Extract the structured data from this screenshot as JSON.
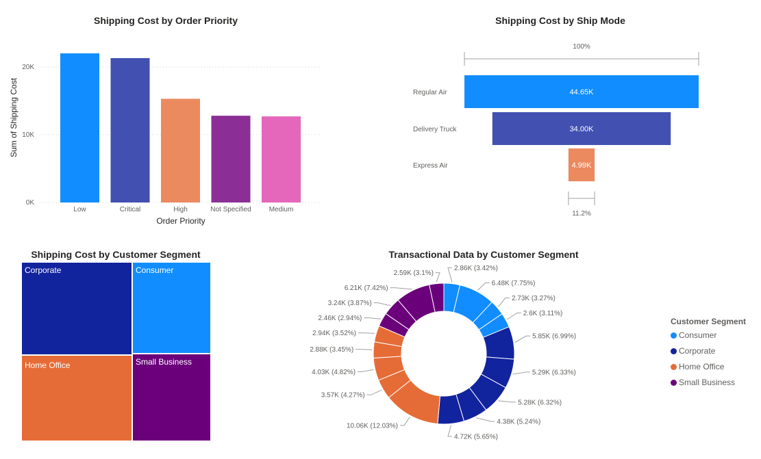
{
  "colors": {
    "Consumer": "#118DFF",
    "Corporate": "#12239E",
    "Home Office": "#E66C37",
    "Small Business": "#6B007B",
    "Not Specified": "#8B2F96",
    "Medium": "#E467BC",
    "Critical": "#4250B1",
    "High": "#EB895F"
  },
  "chart_data": [
    {
      "type": "bar",
      "title": "Shipping Cost by Order Priority",
      "xlabel": "Order Priority",
      "ylabel": "Sum of Shipping Cost",
      "categories": [
        "Low",
        "Critical",
        "High",
        "Not Specified",
        "Medium"
      ],
      "values": [
        22000,
        21300,
        15300,
        12800,
        12700
      ],
      "colors": [
        "#118DFF",
        "#4250B1",
        "#EB895F",
        "#8B2F96",
        "#E467BC"
      ],
      "yticks": [
        0,
        10000,
        20000
      ],
      "ytick_labels": [
        "0K",
        "10K",
        "20K"
      ],
      "ylim": [
        0,
        22000
      ]
    },
    {
      "type": "bar",
      "subtype": "funnel",
      "title": "Shipping Cost by Ship Mode",
      "categories": [
        "Regular Air",
        "Delivery Truck",
        "Express Air"
      ],
      "values": [
        44650,
        34000,
        4990
      ],
      "value_labels": [
        "44.65K",
        "34.00K",
        "4.99K"
      ],
      "colors": [
        "#118DFF",
        "#4250B1",
        "#EB895F"
      ],
      "top_percent_label": "100%",
      "bottom_percent_label": "11.2%"
    },
    {
      "type": "heatmap",
      "subtype": "treemap",
      "title": "Shipping Cost by Customer Segment",
      "categories": [
        "Corporate",
        "Consumer",
        "Home Office",
        "Small Business"
      ]
    },
    {
      "type": "pie",
      "subtype": "donut",
      "title": "Transactional Data by Customer Segment",
      "legend_title": "Customer Segment",
      "legend": [
        "Consumer",
        "Corporate",
        "Home Office",
        "Small Business"
      ],
      "legend_position": "right",
      "slices": [
        {
          "segment": "Consumer",
          "value": 2860,
          "label": "2.86K (3.42%)"
        },
        {
          "segment": "Consumer",
          "value": 6480,
          "label": "6.48K (7.75%)"
        },
        {
          "segment": "Consumer",
          "value": 2730,
          "label": "2.73K (3.27%)"
        },
        {
          "segment": "Consumer",
          "value": 2600,
          "label": "2.6K (3.11%)"
        },
        {
          "segment": "Corporate",
          "value": 5850,
          "label": "5.85K (6.99%)"
        },
        {
          "segment": "Corporate",
          "value": 5290,
          "label": "5.29K (6.33%)"
        },
        {
          "segment": "Corporate",
          "value": 5280,
          "label": "5.28K (6.32%)"
        },
        {
          "segment": "Corporate",
          "value": 4380,
          "label": "4.38K (5.24%)"
        },
        {
          "segment": "Corporate",
          "value": 4720,
          "label": "4.72K (5.65%)"
        },
        {
          "segment": "Home Office",
          "value": 10060,
          "label": "10.06K (12.03%)"
        },
        {
          "segment": "Home Office",
          "value": 3570,
          "label": "3.57K (4.27%)"
        },
        {
          "segment": "Home Office",
          "value": 4030,
          "label": "4.03K (4.82%)"
        },
        {
          "segment": "Home Office",
          "value": 2880,
          "label": "2.88K (3.45%)"
        },
        {
          "segment": "Home Office",
          "value": 2940,
          "label": "2.94K (3.52%)"
        },
        {
          "segment": "Small Business",
          "value": 2460,
          "label": "2.46K (2.94%)"
        },
        {
          "segment": "Small Business",
          "value": 3240,
          "label": "3.24K (3.87%)"
        },
        {
          "segment": "Small Business",
          "value": 6210,
          "label": "6.21K (7.42%)"
        },
        {
          "segment": "Small Business",
          "value": 2590,
          "label": "2.59K (3.1%)"
        }
      ]
    }
  ]
}
